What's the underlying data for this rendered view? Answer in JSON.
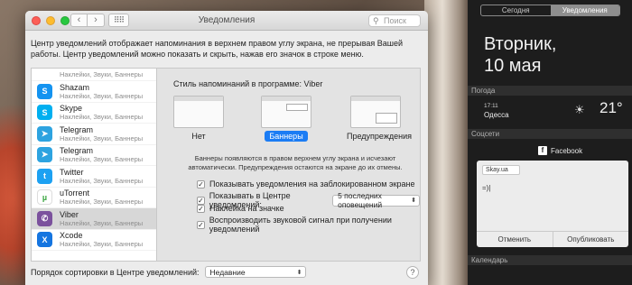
{
  "window": {
    "title": "Уведомления",
    "search_placeholder": "Поиск",
    "back": "‹",
    "forward": "›",
    "grid": "⠿⠿",
    "description": "Центр уведомлений отображает напоминания в верхнем правом углу экрана, не прерывая Вашей работы. Центр уведомлений можно показать и скрыть, нажав его значок в строке меню."
  },
  "apps": [
    {
      "name": "",
      "sub": "Наклейки, Звуки, Баннеры",
      "color": "#cfcfcf",
      "glyph": ""
    },
    {
      "name": "Shazam",
      "sub": "Наклейки, Звуки, Баннеры",
      "color": "#1493f0",
      "glyph": "S"
    },
    {
      "name": "Skype",
      "sub": "Наклейки, Звуки, Баннеры",
      "color": "#00aff0",
      "glyph": "S"
    },
    {
      "name": "Telegram",
      "sub": "Наклейки, Звуки, Баннеры",
      "color": "#2da3e0",
      "glyph": "➤"
    },
    {
      "name": "Telegram",
      "sub": "Наклейки, Звуки, Баннеры",
      "color": "#2da3e0",
      "glyph": "➤"
    },
    {
      "name": "Twitter",
      "sub": "Наклейки, Звуки, Баннеры",
      "color": "#1da1f2",
      "glyph": "t"
    },
    {
      "name": "uTorrent",
      "sub": "Наклейки, Звуки, Баннеры",
      "color": "#ffffff",
      "glyph": "µ"
    },
    {
      "name": "Viber",
      "sub": "Наклейки, Звуки, Баннеры",
      "color": "#7b519d",
      "glyph": "✆"
    },
    {
      "name": "Xcode",
      "sub": "Наклейки, Звуки, Баннеры",
      "color": "#1575e0",
      "glyph": "X"
    }
  ],
  "panel": {
    "style_label": "Стиль напоминаний в программе: Viber",
    "options": [
      "Нет",
      "Баннеры",
      "Предупреждения"
    ],
    "note": "Баннеры появляются в правом верхнем углу экрана и исчезают автоматически. Предупреждения остаются на экране до их отмены.",
    "checkboxes": [
      "Показывать уведомления на заблокированном экране",
      "Показывать в Центре уведомлений:",
      "Наклейка на значке",
      "Воспроизводить звуковой сигнал при получении уведомлений"
    ],
    "recent_select": "5 последних оповещений"
  },
  "sort": {
    "label": "Порядок сортировки в Центре уведомлений:",
    "value": "Недавние"
  },
  "help": "?",
  "nc": {
    "tab_today": "Сегодня",
    "tab_notifications": "Уведомления",
    "day": "Вторник,",
    "date": "10 мая",
    "weather_section": "Погода",
    "weather_time": "17:11",
    "weather_city": "Одесса",
    "weather_temp": "21°",
    "social_section": "Соцсети",
    "facebook": "Facebook",
    "link": "Skay.ua",
    "post_text": "=)|",
    "cancel": "Отменить",
    "publish": "Опубликовать",
    "calendar_section": "Календарь"
  }
}
